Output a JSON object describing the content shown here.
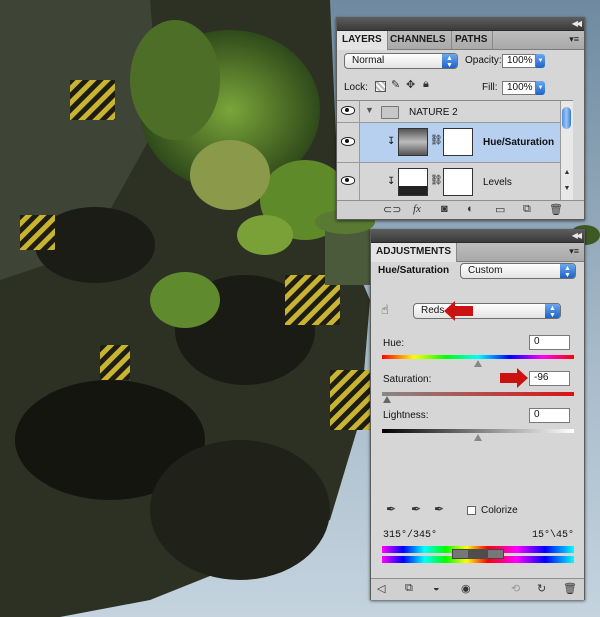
{
  "layers_panel": {
    "tabs": [
      "LAYERS",
      "CHANNELS",
      "PATHS"
    ],
    "blend_mode": "Normal",
    "opacity_label": "Opacity:",
    "opacity_value": "100%",
    "lock_label": "Lock:",
    "fill_label": "Fill:",
    "fill_value": "100%",
    "layers": [
      {
        "name": "NATURE 2",
        "type": "group"
      },
      {
        "name": "Hue/Saturation",
        "type": "adjustment",
        "selected": true
      },
      {
        "name": "Levels",
        "type": "adjustment"
      }
    ],
    "bottom_icons": [
      "link-icon",
      "fx-icon",
      "mask-icon",
      "adjustment-icon",
      "folder-icon",
      "new-layer-icon",
      "trash-icon"
    ],
    "fx_label": "fx"
  },
  "adjustments_panel": {
    "tab": "ADJUSTMENTS",
    "title": "Hue/Saturation",
    "preset": "Custom",
    "channel": "Reds",
    "hue_label": "Hue:",
    "hue_value": "0",
    "saturation_label": "Saturation:",
    "saturation_value": "-96",
    "lightness_label": "Lightness:",
    "lightness_value": "0",
    "colorize_label": "Colorize",
    "range_left": "315°/345°",
    "range_right": "15°\\45°",
    "levels": {
      "hue": 0,
      "saturation": -96,
      "lightness": 0
    },
    "accent_color": "#cc1111"
  }
}
